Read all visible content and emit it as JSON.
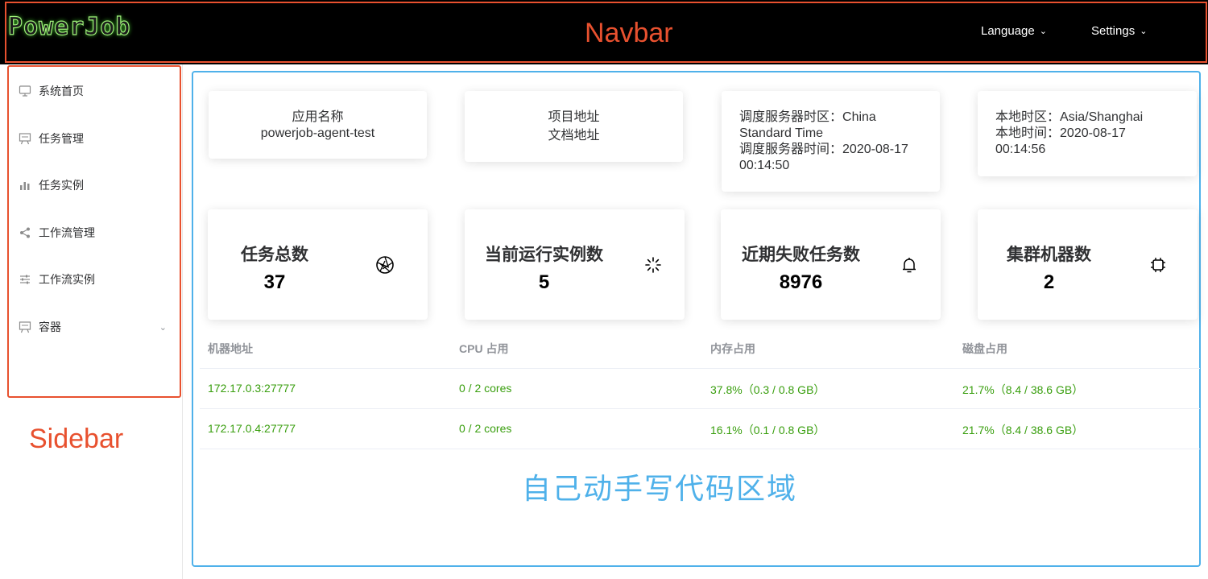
{
  "navbar": {
    "logo_text": "PowerJob",
    "annotation": "Navbar",
    "language_label": "Language",
    "settings_label": "Settings"
  },
  "sidebar": {
    "annotation": "Sidebar",
    "items": [
      {
        "label": "系统首页",
        "icon": "monitor-icon"
      },
      {
        "label": "任务管理",
        "icon": "board-icon"
      },
      {
        "label": "任务实例",
        "icon": "bar-chart-icon"
      },
      {
        "label": "工作流管理",
        "icon": "share-icon"
      },
      {
        "label": "工作流实例",
        "icon": "sliders-icon"
      },
      {
        "label": "容器",
        "icon": "board-icon"
      }
    ]
  },
  "info": {
    "app_label": "应用名称",
    "app_name": "powerjob-agent-test",
    "project_link": "项目地址",
    "docs_link": "文档地址",
    "server_tz_label": "调度服务器时区：",
    "server_tz_value": "China Standard Time",
    "server_time_label": "调度服务器时间：",
    "server_time_value": "2020-08-17 00:14:50",
    "local_tz_label": "本地时区：",
    "local_tz_value": "Asia/Shanghai",
    "local_time_label": "本地时间：",
    "local_time_value": "2020-08-17 00:14:56"
  },
  "stats": [
    {
      "title": "任务总数",
      "value": "37",
      "icon": "aperture-icon"
    },
    {
      "title": "当前运行实例数",
      "value": "5",
      "icon": "loading-icon"
    },
    {
      "title": "近期失败任务数",
      "value": "8976",
      "icon": "bell-icon"
    },
    {
      "title": "集群机器数",
      "value": "2",
      "icon": "cpu-icon"
    }
  ],
  "table": {
    "headers": [
      "机器地址",
      "CPU 占用",
      "内存占用",
      "磁盘占用"
    ],
    "rows": [
      [
        "172.17.0.3:27777",
        "0 / 2 cores",
        "37.8%（0.3 / 0.8 GB）",
        "21.7%（8.4 / 38.6 GB）"
      ],
      [
        "172.17.0.4:27777",
        "0 / 2 cores",
        "16.1%（0.1 / 0.8 GB）",
        "21.7%（8.4 / 38.6 GB）"
      ]
    ]
  },
  "code_area_annotation": "自己动手写代码区域",
  "colors": {
    "annotation_red": "#e8512f",
    "annotation_blue": "#4fb1ea",
    "value_green": "#389e0d"
  }
}
